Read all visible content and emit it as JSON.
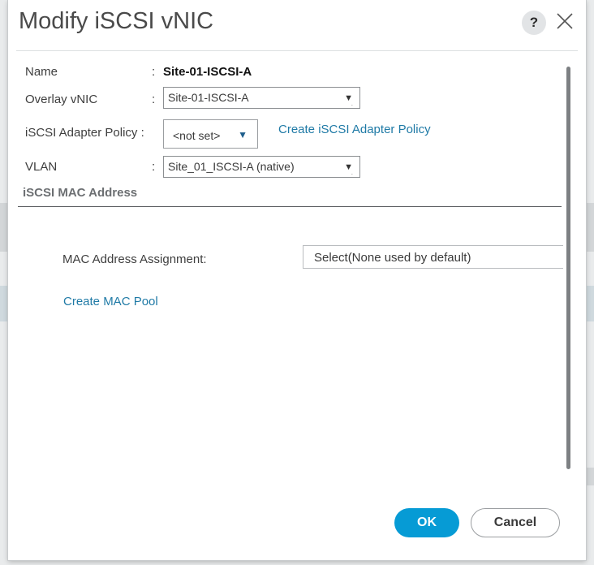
{
  "dialog": {
    "title": "Modify iSCSI vNIC",
    "help_label": "?",
    "close_icon": "close-icon"
  },
  "form": {
    "name": {
      "label": "Name",
      "colon": ":",
      "value": "Site-01-ISCSI-A"
    },
    "overlay_vnic": {
      "label": "Overlay vNIC",
      "colon": ":",
      "value": "Site-01-ISCSI-A"
    },
    "adapter_policy": {
      "label": "iSCSI Adapter Policy :",
      "value": "<not set>",
      "create_link": "Create iSCSI Adapter Policy"
    },
    "vlan": {
      "label": "VLAN",
      "colon": ":",
      "value": "Site_01_ISCSI-A (native)"
    }
  },
  "mac_section": {
    "title": "iSCSI MAC Address",
    "assignment_label": "MAC Address Assignment:",
    "assignment_value": "Select(None used by default)",
    "create_link": "Create MAC Pool"
  },
  "footer": {
    "ok_label": "OK",
    "cancel_label": "Cancel"
  },
  "colors": {
    "accent": "#069bd5",
    "link": "#1f7aa6",
    "dropdown_arrow_blue": "#1f5f8c"
  }
}
